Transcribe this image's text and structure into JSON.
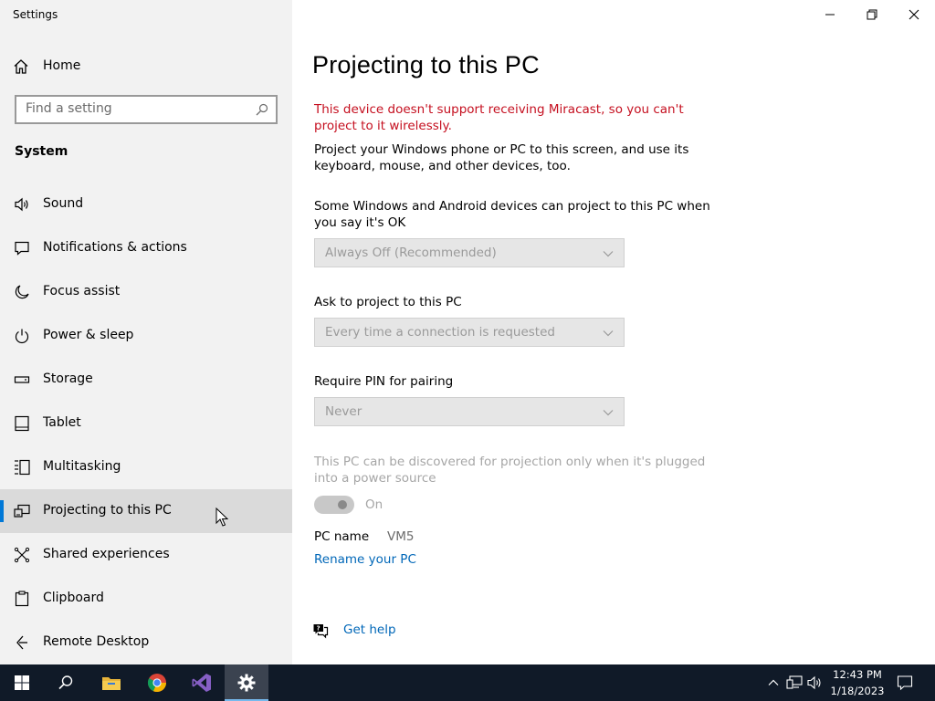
{
  "window": {
    "app_title": "Settings",
    "controls": [
      "minimize",
      "restore",
      "close"
    ]
  },
  "sidebar": {
    "home_label": "Home",
    "search_placeholder": "Find a setting",
    "section_label": "System",
    "items": [
      {
        "label": "Sound",
        "icon": "speaker-icon"
      },
      {
        "label": "Notifications & actions",
        "icon": "notification-icon"
      },
      {
        "label": "Focus assist",
        "icon": "moon-icon"
      },
      {
        "label": "Power & sleep",
        "icon": "power-icon"
      },
      {
        "label": "Storage",
        "icon": "storage-icon"
      },
      {
        "label": "Tablet",
        "icon": "tablet-icon"
      },
      {
        "label": "Multitasking",
        "icon": "multitasking-icon"
      },
      {
        "label": "Projecting to this PC",
        "icon": "projecting-icon",
        "selected": true
      },
      {
        "label": "Shared experiences",
        "icon": "shared-experiences-icon"
      },
      {
        "label": "Clipboard",
        "icon": "clipboard-icon"
      },
      {
        "label": "Remote Desktop",
        "icon": "remote-desktop-icon"
      }
    ]
  },
  "main": {
    "title": "Projecting to this PC",
    "error_text": "This device doesn't support receiving Miracast, so you can't project to it wirelessly.",
    "intro_text": "Project your Windows phone or PC to this screen, and use its keyboard, mouse, and other devices, too.",
    "setting1_label": "Some Windows and Android devices can project to this PC when you say it's OK",
    "setting1_value": "Always Off (Recommended)",
    "setting2_label": "Ask to project to this PC",
    "setting2_value": "Every time a connection is requested",
    "setting3_label": "Require PIN for pairing",
    "setting3_value": "Never",
    "power_note": "This PC can be discovered for projection only when it's plugged into a power source",
    "toggle_label": "On",
    "toggle_on": true,
    "pc_name_label": "PC name",
    "pc_name_value": "VM5",
    "rename_link": "Rename your PC",
    "help_link": "Get help"
  },
  "taskbar": {
    "apps": [
      "start-icon",
      "search-icon",
      "file-explorer-icon",
      "chrome-icon",
      "visual-studio-icon",
      "settings-icon"
    ],
    "active_app": "settings-icon",
    "time": "12:43 PM",
    "date": "1/18/2023"
  },
  "colors": {
    "accent": "#0078d7",
    "error": "#c50f1f",
    "link": "#0067b8",
    "taskbar": "#101a28"
  }
}
